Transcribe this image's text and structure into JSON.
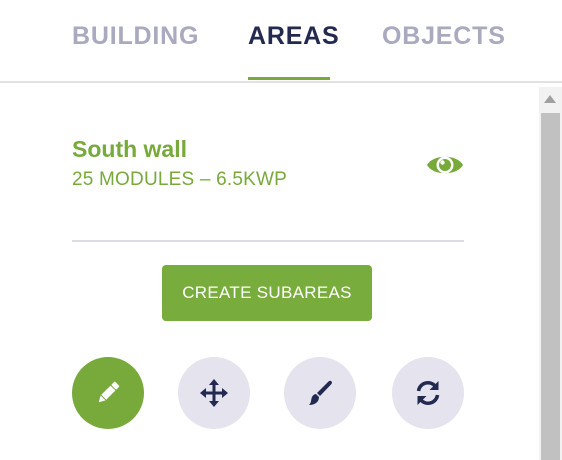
{
  "tabs": [
    {
      "label": "BUILDING",
      "active": false
    },
    {
      "label": "AREAS",
      "active": true
    },
    {
      "label": "OBJECTS",
      "active": false
    }
  ],
  "area": {
    "name": "South wall",
    "summary": "25 MODULES – 6.5KWP",
    "visible_icon": "eye-icon"
  },
  "actions": {
    "create_subareas_label": "CREATE SUBAREAS"
  },
  "tools": [
    {
      "icon": "pencil-icon",
      "active": true
    },
    {
      "icon": "move-arrows-icon",
      "active": false
    },
    {
      "icon": "paint-brush-icon",
      "active": false
    },
    {
      "icon": "refresh-icon",
      "active": false
    }
  ],
  "colors": {
    "accent": "#77a93b",
    "tab_active": "#232a4f",
    "tab_inactive": "#a9a9bf",
    "tool_bg": "#e4e3ee",
    "icon_dark": "#232a4f"
  }
}
